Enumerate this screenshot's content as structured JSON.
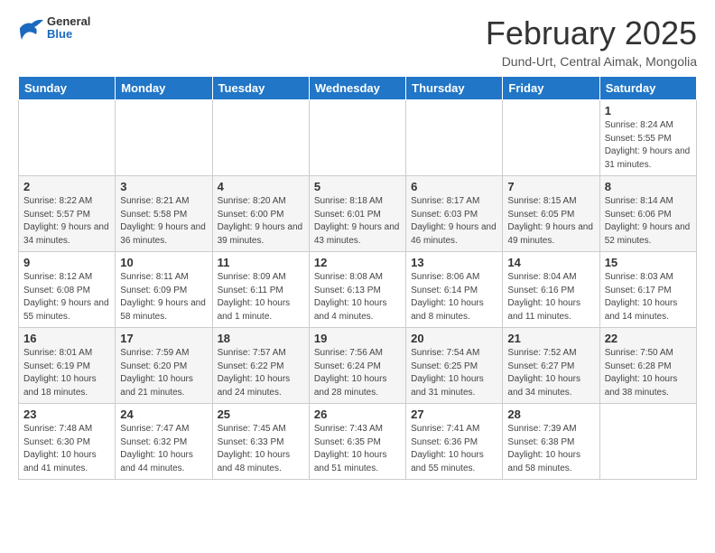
{
  "header": {
    "logo_general": "General",
    "logo_blue": "Blue",
    "month_title": "February 2025",
    "subtitle": "Dund-Urt, Central Aimak, Mongolia"
  },
  "weekdays": [
    "Sunday",
    "Monday",
    "Tuesday",
    "Wednesday",
    "Thursday",
    "Friday",
    "Saturday"
  ],
  "weeks": [
    [
      {
        "day": "",
        "info": ""
      },
      {
        "day": "",
        "info": ""
      },
      {
        "day": "",
        "info": ""
      },
      {
        "day": "",
        "info": ""
      },
      {
        "day": "",
        "info": ""
      },
      {
        "day": "",
        "info": ""
      },
      {
        "day": "1",
        "info": "Sunrise: 8:24 AM\nSunset: 5:55 PM\nDaylight: 9 hours and 31 minutes."
      }
    ],
    [
      {
        "day": "2",
        "info": "Sunrise: 8:22 AM\nSunset: 5:57 PM\nDaylight: 9 hours and 34 minutes."
      },
      {
        "day": "3",
        "info": "Sunrise: 8:21 AM\nSunset: 5:58 PM\nDaylight: 9 hours and 36 minutes."
      },
      {
        "day": "4",
        "info": "Sunrise: 8:20 AM\nSunset: 6:00 PM\nDaylight: 9 hours and 39 minutes."
      },
      {
        "day": "5",
        "info": "Sunrise: 8:18 AM\nSunset: 6:01 PM\nDaylight: 9 hours and 43 minutes."
      },
      {
        "day": "6",
        "info": "Sunrise: 8:17 AM\nSunset: 6:03 PM\nDaylight: 9 hours and 46 minutes."
      },
      {
        "day": "7",
        "info": "Sunrise: 8:15 AM\nSunset: 6:05 PM\nDaylight: 9 hours and 49 minutes."
      },
      {
        "day": "8",
        "info": "Sunrise: 8:14 AM\nSunset: 6:06 PM\nDaylight: 9 hours and 52 minutes."
      }
    ],
    [
      {
        "day": "9",
        "info": "Sunrise: 8:12 AM\nSunset: 6:08 PM\nDaylight: 9 hours and 55 minutes."
      },
      {
        "day": "10",
        "info": "Sunrise: 8:11 AM\nSunset: 6:09 PM\nDaylight: 9 hours and 58 minutes."
      },
      {
        "day": "11",
        "info": "Sunrise: 8:09 AM\nSunset: 6:11 PM\nDaylight: 10 hours and 1 minute."
      },
      {
        "day": "12",
        "info": "Sunrise: 8:08 AM\nSunset: 6:13 PM\nDaylight: 10 hours and 4 minutes."
      },
      {
        "day": "13",
        "info": "Sunrise: 8:06 AM\nSunset: 6:14 PM\nDaylight: 10 hours and 8 minutes."
      },
      {
        "day": "14",
        "info": "Sunrise: 8:04 AM\nSunset: 6:16 PM\nDaylight: 10 hours and 11 minutes."
      },
      {
        "day": "15",
        "info": "Sunrise: 8:03 AM\nSunset: 6:17 PM\nDaylight: 10 hours and 14 minutes."
      }
    ],
    [
      {
        "day": "16",
        "info": "Sunrise: 8:01 AM\nSunset: 6:19 PM\nDaylight: 10 hours and 18 minutes."
      },
      {
        "day": "17",
        "info": "Sunrise: 7:59 AM\nSunset: 6:20 PM\nDaylight: 10 hours and 21 minutes."
      },
      {
        "day": "18",
        "info": "Sunrise: 7:57 AM\nSunset: 6:22 PM\nDaylight: 10 hours and 24 minutes."
      },
      {
        "day": "19",
        "info": "Sunrise: 7:56 AM\nSunset: 6:24 PM\nDaylight: 10 hours and 28 minutes."
      },
      {
        "day": "20",
        "info": "Sunrise: 7:54 AM\nSunset: 6:25 PM\nDaylight: 10 hours and 31 minutes."
      },
      {
        "day": "21",
        "info": "Sunrise: 7:52 AM\nSunset: 6:27 PM\nDaylight: 10 hours and 34 minutes."
      },
      {
        "day": "22",
        "info": "Sunrise: 7:50 AM\nSunset: 6:28 PM\nDaylight: 10 hours and 38 minutes."
      }
    ],
    [
      {
        "day": "23",
        "info": "Sunrise: 7:48 AM\nSunset: 6:30 PM\nDaylight: 10 hours and 41 minutes."
      },
      {
        "day": "24",
        "info": "Sunrise: 7:47 AM\nSunset: 6:32 PM\nDaylight: 10 hours and 44 minutes."
      },
      {
        "day": "25",
        "info": "Sunrise: 7:45 AM\nSunset: 6:33 PM\nDaylight: 10 hours and 48 minutes."
      },
      {
        "day": "26",
        "info": "Sunrise: 7:43 AM\nSunset: 6:35 PM\nDaylight: 10 hours and 51 minutes."
      },
      {
        "day": "27",
        "info": "Sunrise: 7:41 AM\nSunset: 6:36 PM\nDaylight: 10 hours and 55 minutes."
      },
      {
        "day": "28",
        "info": "Sunrise: 7:39 AM\nSunset: 6:38 PM\nDaylight: 10 hours and 58 minutes."
      },
      {
        "day": "",
        "info": ""
      }
    ]
  ]
}
